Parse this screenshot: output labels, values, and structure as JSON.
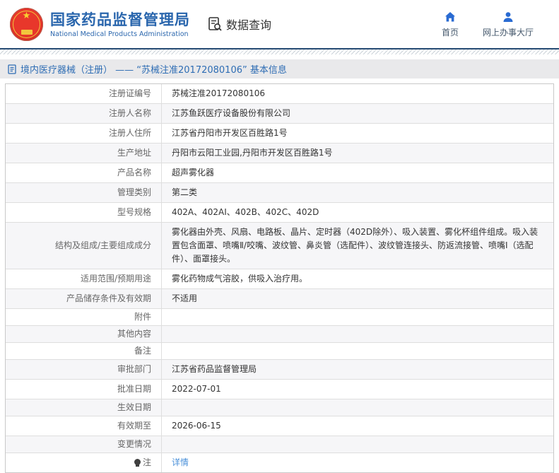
{
  "header": {
    "site_title": "国家药品监督管理局",
    "site_subtitle": "National Medical Products Administration",
    "section_label": "数据查询",
    "nav": [
      {
        "label": "首页",
        "icon": "home-icon"
      },
      {
        "label": "网上办事大厅",
        "icon": "user-icon"
      }
    ]
  },
  "page_title": {
    "text": "境内医疗器械（注册） —— “苏械注准20172080106” 基本信息",
    "icon": "document-icon"
  },
  "detail_table": {
    "rows": [
      {
        "label": "注册证编号",
        "value": "苏械注准20172080106"
      },
      {
        "label": "注册人名称",
        "value": "江苏鱼跃医疗设备股份有限公司"
      },
      {
        "label": "注册人住所",
        "value": "江苏省丹阳市开发区百胜路1号"
      },
      {
        "label": "生产地址",
        "value": "丹阳市云阳工业园,丹阳市开发区百胜路1号"
      },
      {
        "label": "产品名称",
        "value": "超声雾化器"
      },
      {
        "label": "管理类别",
        "value": "第二类"
      },
      {
        "label": "型号规格",
        "value": "402A、402AI、402B、402C、402D"
      },
      {
        "label": "结构及组成/主要组成成分",
        "value": "雾化器由外壳、风扇、电路板、晶片、定时器（402D除外）、吸入装置、雾化杯组件组成。吸入装置包含面罩、喷嘴Ⅱ/咬嘴、波纹管、鼻炎管（选配件）、波纹管连接头、防返流接管、喷嘴Ⅰ（选配件）、面罩接头。"
      },
      {
        "label": "适用范围/预期用途",
        "value": "雾化药物成气溶胶，供吸入治疗用。"
      },
      {
        "label": "产品储存条件及有效期",
        "value": "不适用"
      },
      {
        "label": "附件",
        "value": ""
      },
      {
        "label": "其他内容",
        "value": ""
      },
      {
        "label": "备注",
        "value": ""
      },
      {
        "label": "审批部门",
        "value": "江苏省药品监督管理局"
      },
      {
        "label": "批准日期",
        "value": "2022-07-01"
      },
      {
        "label": "生效日期",
        "value": ""
      },
      {
        "label": "有效期至",
        "value": "2026-06-15"
      },
      {
        "label": "变更情况",
        "value": ""
      },
      {
        "label": "注",
        "label_icon": "note-bulb-icon",
        "value": "详情",
        "value_type": "link"
      }
    ]
  },
  "colors": {
    "brand_blue": "#2a66ad",
    "title_blue": "#2e6db4",
    "nav_icon_blue": "#2a6bd2",
    "link_blue": "#4a90d9",
    "title_bar_bg": "#e9e9eb",
    "alt_row_bg": "#f6f6f8",
    "table_border": "#c9c9c9"
  }
}
